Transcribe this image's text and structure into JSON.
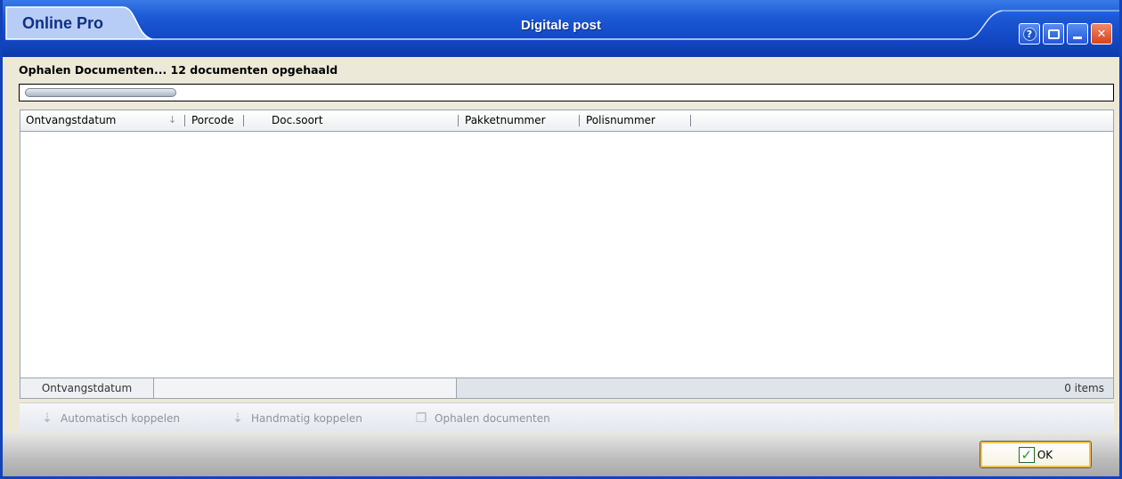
{
  "window": {
    "app_name": "Online Pro",
    "title": "Digitale post",
    "buttons": [
      "help",
      "screenshot",
      "minimize",
      "close"
    ]
  },
  "status": {
    "text": "Ophalen Documenten... 12 documenten opgehaald",
    "progress_fraction": 0.14
  },
  "grid": {
    "columns": [
      "Ontvangstdatum",
      "Porcode",
      "Doc.soort",
      "Pakketnummer",
      "Polisnummer"
    ],
    "sort_column": "Ontvangstdatum",
    "rows": [],
    "footer": {
      "group_field": "Ontvangstdatum",
      "item_count": "0 items"
    }
  },
  "toolbar": {
    "auto_link": "Automatisch koppelen",
    "manual_link": "Handmatig koppelen",
    "fetch_docs": "Ophalen documenten"
  },
  "footer": {
    "ok_label": "OK"
  },
  "icons": {
    "help": "question-icon",
    "screenshot": "screenshot-icon",
    "minimize": "minimize-icon",
    "close": "close-icon",
    "ok": "checkmark-icon"
  },
  "colors": {
    "titlebar": "#1c59d4",
    "border": "#1243b8",
    "ok_highlight": "#f2c14e"
  }
}
